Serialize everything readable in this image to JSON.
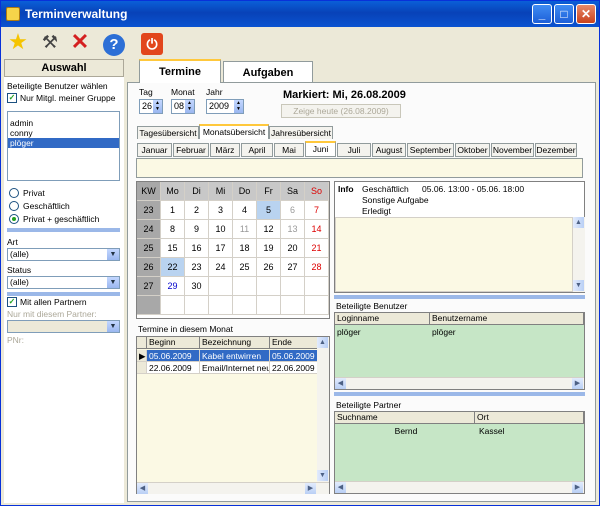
{
  "window": {
    "title": "Terminverwaltung"
  },
  "toolbar": {
    "icons": [
      "star-icon",
      "tools-icon",
      "delete-icon",
      "help-icon",
      "power-icon"
    ],
    "help_glyph": "?"
  },
  "sidebar": {
    "header": "Auswahl",
    "users_label": "Beteiligte Benutzer wählen",
    "group_only_label": "Nur Mitgl. meiner Gruppe",
    "users": [
      "admin",
      "conny",
      "plöger"
    ],
    "selected_user": "plöger",
    "radio_private": "Privat",
    "radio_business": "Geschäftlich",
    "radio_both": "Privat + geschäftlich",
    "art_label": "Art",
    "art_value": "(alle)",
    "status_label": "Status",
    "status_value": "(alle)",
    "partners_label": "Mit allen Partnern",
    "partner_only_label": "Nur mit diesem Partner:",
    "pnr_label": "PNr:"
  },
  "tabs": [
    "Termine",
    "Aufgaben"
  ],
  "date": {
    "tag_label": "Tag",
    "monat_label": "Monat",
    "jahr_label": "Jahr",
    "tag": "26",
    "monat": "08",
    "jahr": "2009"
  },
  "marked": "Markiert: Mi, 26.08.2009",
  "today_button": "Zeige heute (26.08.2009)",
  "subtabs": [
    "Tagesübersicht",
    "Monatsübersicht",
    "Jahresübersicht"
  ],
  "months": [
    "Januar",
    "Februar",
    "März",
    "April",
    "Mai",
    "Juni",
    "Juli",
    "August",
    "September",
    "Oktober",
    "November",
    "Dezember"
  ],
  "calendar": {
    "headers": [
      "KW",
      "Mo",
      "Di",
      "Mi",
      "Do",
      "Fr",
      "Sa",
      "So"
    ],
    "weeks": [
      [
        "23",
        "1",
        "2",
        "3",
        "4",
        "5",
        "6",
        "7"
      ],
      [
        "24",
        "8",
        "9",
        "10",
        "11",
        "12",
        "13",
        "14"
      ],
      [
        "25",
        "15",
        "16",
        "17",
        "18",
        "19",
        "20",
        "21"
      ],
      [
        "26",
        "22",
        "23",
        "24",
        "25",
        "26",
        "27",
        "28"
      ],
      [
        "27",
        "29",
        "30",
        "",
        "",
        "",
        "",
        ""
      ]
    ]
  },
  "month_appts": {
    "label": "Termine in diesem Monat",
    "headers": [
      "Beginn",
      "Bezeichnung",
      "Ende"
    ],
    "rows": [
      {
        "begin": "05.06.2009",
        "desc": "Kabel entwirren",
        "end": "05.06.2009"
      },
      {
        "begin": "22.06.2009",
        "desc": "Email/Internet neu ei",
        "end": "22.06.2009"
      }
    ]
  },
  "info": {
    "label": "Info",
    "type": "Geschäftlich",
    "time": "05.06. 13:00 - 05.06. 18:00",
    "category": "Sonstige Aufgabe",
    "status": "Erledigt"
  },
  "users_grid": {
    "label": "Beteiligte Benutzer",
    "headers": [
      "Loginname",
      "Benutzername"
    ],
    "rows": [
      {
        "login": "plöger",
        "name": "plöger"
      }
    ]
  },
  "partners_grid": {
    "label": "Beteiligte Partner",
    "headers": [
      "Suchname",
      "Ort"
    ],
    "rows": [
      {
        "search": "Bernd",
        "ort": "Kassel"
      }
    ]
  }
}
